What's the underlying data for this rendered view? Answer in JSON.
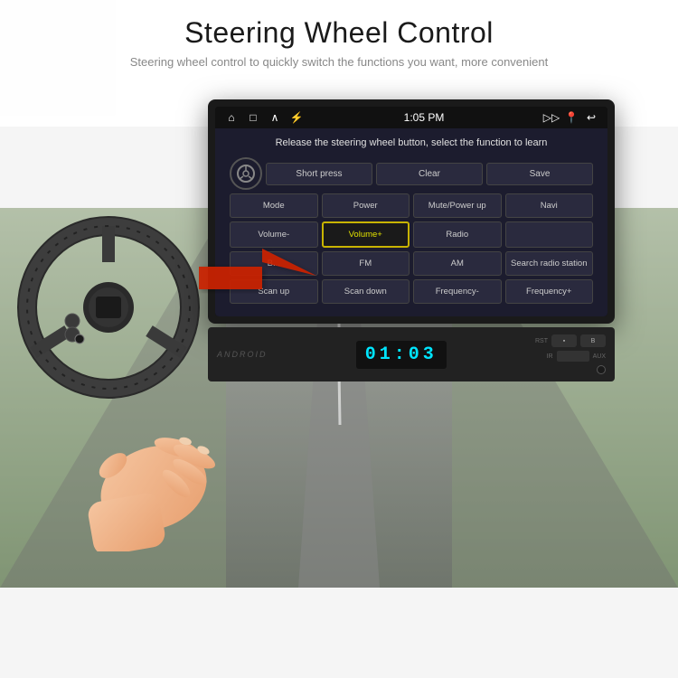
{
  "header": {
    "title": "Steering Wheel Control",
    "subtitle": "Steering wheel control to quickly switch the functions you want, more convenient"
  },
  "screen": {
    "statusBar": {
      "time": "1:05 PM",
      "icons": [
        "⌂",
        "□",
        "∧",
        "⚡"
      ],
      "rightIcons": [
        "cast",
        "📍",
        "↩"
      ]
    },
    "instructionText": "Release the steering wheel button, select the function to learn",
    "topButtons": [
      "Short press",
      "Clear",
      "Save"
    ],
    "gridRows": [
      [
        "Mode",
        "Power",
        "Mute/Power up",
        "Navi"
      ],
      [
        "Volume-",
        "Volume+",
        "Radio",
        ""
      ],
      [
        "B...",
        "FM",
        "AM",
        "Search radio station"
      ],
      [
        "Scan up",
        "Scan down",
        "Frequency-",
        "Frequency+"
      ]
    ],
    "highlightedButton": "Volume+"
  },
  "physicalUnit": {
    "display": "01:03",
    "labels": {
      "rst": "RST",
      "ir": "IR",
      "aux": "AUX",
      "b": "B"
    }
  },
  "colors": {
    "screenBg": "#1c1c2e",
    "buttonBg": "#2a2a3e",
    "buttonBorder": "#444444",
    "buttonText": "#cccccc",
    "highlightBorder": "#c8b400",
    "highlightText": "#e0e000",
    "displayColor": "#00e5ff",
    "arrowRed": "#cc2200"
  }
}
